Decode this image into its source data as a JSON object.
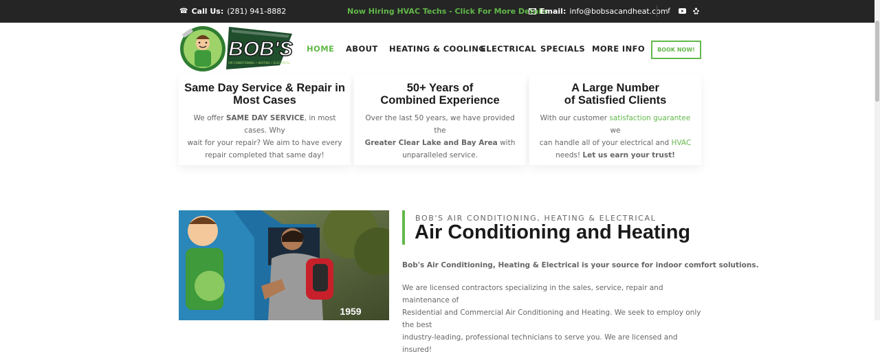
{
  "topbar": {
    "call_label": "Call Us:",
    "call_number": "(281) 941-8882",
    "hiring": "Now Hiring HVAC Techs - Click For More Details",
    "email_label": "Email:",
    "email": "info@bobsacandheat.com"
  },
  "header": {
    "logo_text": "BOB'S",
    "logo_sub": "AIR CONDITIONING • HEATING • ELECTRICAL",
    "nav": [
      "HOME",
      "ABOUT",
      "HEATING & COOLING",
      "ELECTRICAL",
      "SPECIALS",
      "MORE INFO"
    ],
    "book_label": "BOOK NOW!"
  },
  "cards": [
    {
      "title_1": "Same Day Service & Repair in",
      "title_2": "Most Cases",
      "p1a": "We offer ",
      "p1b": "SAME DAY SERVICE",
      "p1c": ", in most cases. Why",
      "p2": "wait for your repair? We aim to have every",
      "p3": "repair completed that same day!"
    },
    {
      "title_1": "50+ Years of",
      "title_2": "Combined Experience",
      "p1": "Over the last 50 years, we have provided the",
      "p2a": "Greater Clear Lake and Bay Area",
      "p2b": " with",
      "p3": "unparalleled service."
    },
    {
      "title_1": "A Large Number",
      "title_2": "of Satisfied Clients",
      "p1a": "With our customer ",
      "p1b": "satisfaction guarantee",
      "p1c": " we",
      "p2a": "can handle all of your electrical and ",
      "p2b": "HVAC",
      "p3a": "needs! ",
      "p3b": "Let us earn your trust!"
    }
  ],
  "about": {
    "eyebrow": "BOB'S AIR CONDITIONING, HEATING & ELECTRICAL",
    "title": "Air Conditioning and Heating",
    "lead": "Bob's Air Conditioning, Heating & Electrical is your source for indoor comfort solutions.",
    "body_1": "We are licensed contractors specializing in the sales, service, repair and maintenance of",
    "body_2": "Residential and Commercial Air Conditioning and Heating. We seek to employ only the best",
    "body_3": "industry-leading, professional technicians to serve you. We are licensed and insured!",
    "van_number": "1959"
  },
  "colors": {
    "accent": "#62b84a",
    "topbar": "#252525",
    "heading": "#1a1a1a",
    "text": "#666666"
  },
  "icons": [
    "phone-icon",
    "envelope-icon",
    "facebook-icon",
    "youtube-icon",
    "yelp-icon"
  ]
}
